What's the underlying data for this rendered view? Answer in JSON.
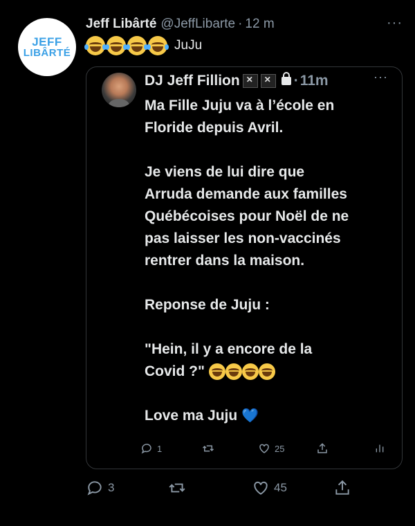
{
  "tweet": {
    "avatar_line1": "JEFF",
    "avatar_line2": "LIBÂRTÉ",
    "name": "Jeff Libârté",
    "handle": "@JeffLibarte",
    "separator": "·",
    "time": "12 m",
    "more": "···",
    "text": "JuJu",
    "emoji_count": 4,
    "reply_count": "3",
    "like_count": "45"
  },
  "quote": {
    "name": "DJ Jeff Fillion",
    "separator": "·",
    "time": "11m",
    "more": "···",
    "paragraphs": [
      "Ma Fille Juju va à l’école en\nFloride depuis Avril.",
      "Je viens de lui dire que\nArruda demande aux familles\nQuébécoises pour Noël de ne\npas laisser les non-vaccinés\nrentrer dans la maison.",
      "Reponse de Juju :",
      "\"Hein, il y a encore de la\nCovid ?\""
    ],
    "closing": "Love ma Juju",
    "heart": "💙",
    "reply_count": "1",
    "like_count": "25"
  },
  "colors": {
    "background": "#000000",
    "text": "#e7e9ea",
    "secondary": "#8b98a5",
    "brand_blue": "#3aa0e6"
  },
  "icons": [
    "reply-icon",
    "retweet-icon",
    "like-icon",
    "share-icon",
    "analytics-icon",
    "lock-icon",
    "pirate-flag-icon",
    "tears-of-joy-emoji"
  ]
}
